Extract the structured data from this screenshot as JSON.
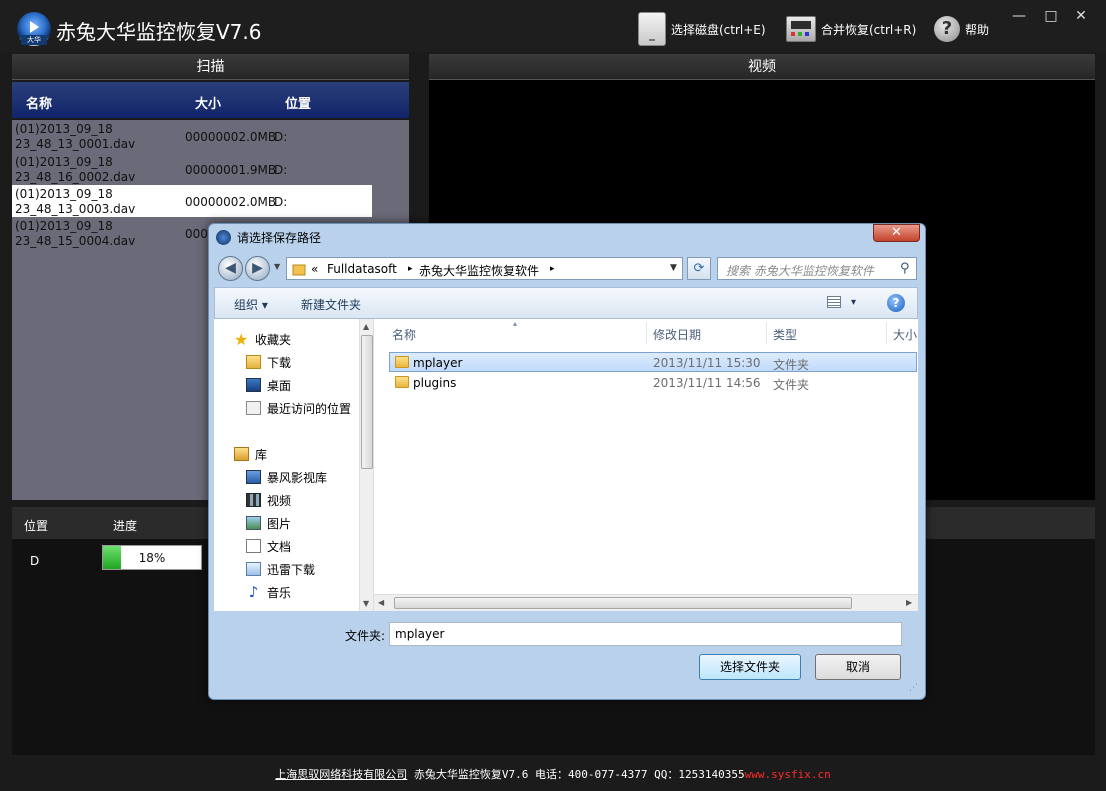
{
  "app": {
    "logo_tag": "大华",
    "title": "赤兔大华监控恢复V7.6",
    "select_disk": "选择磁盘(ctrl+E)",
    "merge_recover": "合并恢复(ctrl+R)",
    "help": "帮助",
    "help_glyph": "?",
    "minimize": "—",
    "maximize": "□",
    "close": "✕"
  },
  "scan": {
    "header": "扫描",
    "col_name": "名称",
    "col_size": "大小",
    "col_pos": "位置",
    "files": [
      {
        "name1": "(01)2013_09_18",
        "name2": "23_48_13_0001.dav",
        "size": "00000002.0MB",
        "pos": "D:"
      },
      {
        "name1": "(01)2013_09_18",
        "name2": "23_48_16_0002.dav",
        "size": "00000001.9MB",
        "pos": "D:"
      },
      {
        "name1": "(01)2013_09_18",
        "name2": "23_48_13_0003.dav",
        "size": "00000002.0MB",
        "pos": "D:"
      },
      {
        "name1": "(01)2013_09_18",
        "name2": "23_48_15_0004.dav",
        "size": "000",
        "pos": ""
      }
    ]
  },
  "video": {
    "header": "视频"
  },
  "progress": {
    "col_pos": "位置",
    "col_progress": "进度",
    "row_pos": "D",
    "value": 0.18,
    "label": "18%",
    "colors": {
      "fill": "#1fa61f"
    }
  },
  "footer": {
    "company": "上海思驭网络科技有限公司",
    "text": " 赤兔大华监控恢复V7.6 电话：400-077-4377 QQ：1253140355",
    "url": "www.sysfix.cn"
  },
  "dialog": {
    "title": "请选择保存路径",
    "close": "✕",
    "address": {
      "chevrons": "«",
      "seg1": "Fulldatasoft",
      "seg2": "赤兔大华监控恢复软件",
      "arrow": "▸"
    },
    "search_placeholder": "搜索 赤兔大华监控恢复软件",
    "organize": "组织 ▾",
    "new_folder": "新建文件夹",
    "view_drop": "▾",
    "help_glyph": "?",
    "nav": {
      "favorites": "收藏夹",
      "downloads": "下载",
      "desktop": "桌面",
      "recent": "最近访问的位置",
      "library": "库",
      "baofeng": "暴风影视库",
      "videos": "视频",
      "pictures": "图片",
      "documents": "文档",
      "xunlei": "迅雷下载",
      "music": "音乐"
    },
    "columns": {
      "name": "名称",
      "modified": "修改日期",
      "type": "类型",
      "size": "大小"
    },
    "rows": [
      {
        "name": "mplayer",
        "date": "2013/11/11 15:30",
        "type": "文件夹"
      },
      {
        "name": "plugins",
        "date": "2013/11/11 14:56",
        "type": "文件夹"
      }
    ],
    "folder_label": "文件夹:",
    "folder_value": "mplayer",
    "select_button": "选择文件夹",
    "cancel_button": "取消"
  }
}
